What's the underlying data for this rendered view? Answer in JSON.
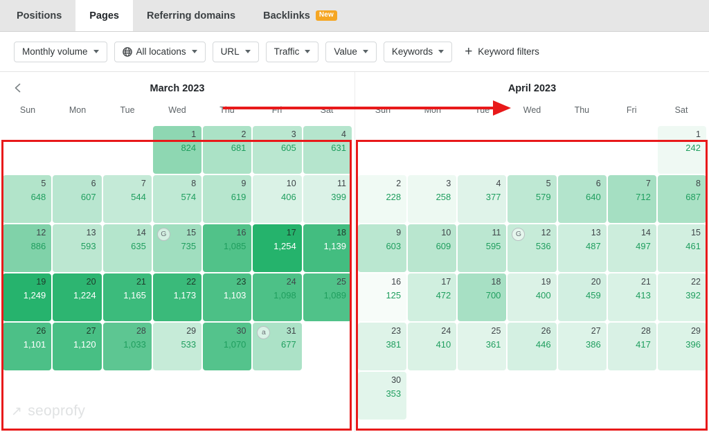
{
  "tabs": [
    {
      "label": "Positions",
      "active": false,
      "badge": null
    },
    {
      "label": "Pages",
      "active": true,
      "badge": null
    },
    {
      "label": "Referring domains",
      "active": false,
      "badge": null
    },
    {
      "label": "Backlinks",
      "active": false,
      "badge": "New"
    }
  ],
  "filters": {
    "buttons": [
      {
        "label": "Monthly volume",
        "icon": null,
        "caret": true
      },
      {
        "label": "All locations",
        "icon": "globe-icon",
        "caret": true
      },
      {
        "label": "URL",
        "icon": null,
        "caret": true
      },
      {
        "label": "Traffic",
        "icon": null,
        "caret": true
      },
      {
        "label": "Value",
        "icon": null,
        "caret": true
      },
      {
        "label": "Keywords",
        "icon": null,
        "caret": true
      }
    ],
    "keyword_filters_label": "Keyword filters",
    "plus_glyph": "+"
  },
  "weekdays": [
    "Sun",
    "Mon",
    "Tue",
    "Wed",
    "Thu",
    "Fri",
    "Sat"
  ],
  "colors": {
    "accent_green": "#1f9e5e",
    "scale_max": "#2eb972",
    "annotation_red": "#e8191a",
    "new_badge": "#f5a623"
  },
  "calendars": [
    {
      "title": "March 2023",
      "has_prev_nav": true,
      "lead_blanks": 3,
      "days": [
        {
          "day": 1,
          "value": "824",
          "n": 824
        },
        {
          "day": 2,
          "value": "681",
          "n": 681
        },
        {
          "day": 3,
          "value": "605",
          "n": 605
        },
        {
          "day": 4,
          "value": "631",
          "n": 631
        },
        {
          "day": 5,
          "value": "648",
          "n": 648
        },
        {
          "day": 6,
          "value": "607",
          "n": 607
        },
        {
          "day": 7,
          "value": "544",
          "n": 544
        },
        {
          "day": 8,
          "value": "574",
          "n": 574
        },
        {
          "day": 9,
          "value": "619",
          "n": 619
        },
        {
          "day": 10,
          "value": "406",
          "n": 406
        },
        {
          "day": 11,
          "value": "399",
          "n": 399
        },
        {
          "day": 12,
          "value": "886",
          "n": 886
        },
        {
          "day": 13,
          "value": "593",
          "n": 593
        },
        {
          "day": 14,
          "value": "635",
          "n": 635
        },
        {
          "day": 15,
          "value": "735",
          "n": 735,
          "badge": "G"
        },
        {
          "day": 16,
          "value": "1,085",
          "n": 1085
        },
        {
          "day": 17,
          "value": "1,254",
          "n": 1254
        },
        {
          "day": 18,
          "value": "1,139",
          "n": 1139
        },
        {
          "day": 19,
          "value": "1,249",
          "n": 1249
        },
        {
          "day": 20,
          "value": "1,224",
          "n": 1224
        },
        {
          "day": 21,
          "value": "1,165",
          "n": 1165
        },
        {
          "day": 22,
          "value": "1,173",
          "n": 1173
        },
        {
          "day": 23,
          "value": "1,103",
          "n": 1103
        },
        {
          "day": 24,
          "value": "1,098",
          "n": 1098
        },
        {
          "day": 25,
          "value": "1,089",
          "n": 1089
        },
        {
          "day": 26,
          "value": "1,101",
          "n": 1101
        },
        {
          "day": 27,
          "value": "1,120",
          "n": 1120
        },
        {
          "day": 28,
          "value": "1,033",
          "n": 1033
        },
        {
          "day": 29,
          "value": "533",
          "n": 533
        },
        {
          "day": 30,
          "value": "1,070",
          "n": 1070
        },
        {
          "day": 31,
          "value": "677",
          "n": 677,
          "badge": "a"
        }
      ]
    },
    {
      "title": "April 2023",
      "has_prev_nav": false,
      "lead_blanks": 6,
      "days": [
        {
          "day": 1,
          "value": "242",
          "n": 242
        },
        {
          "day": 2,
          "value": "228",
          "n": 228
        },
        {
          "day": 3,
          "value": "258",
          "n": 258
        },
        {
          "day": 4,
          "value": "377",
          "n": 377
        },
        {
          "day": 5,
          "value": "579",
          "n": 579
        },
        {
          "day": 6,
          "value": "640",
          "n": 640
        },
        {
          "day": 7,
          "value": "712",
          "n": 712
        },
        {
          "day": 8,
          "value": "687",
          "n": 687
        },
        {
          "day": 9,
          "value": "603",
          "n": 603
        },
        {
          "day": 10,
          "value": "609",
          "n": 609
        },
        {
          "day": 11,
          "value": "595",
          "n": 595
        },
        {
          "day": 12,
          "value": "536",
          "n": 536,
          "badge": "G"
        },
        {
          "day": 13,
          "value": "487",
          "n": 487
        },
        {
          "day": 14,
          "value": "497",
          "n": 497
        },
        {
          "day": 15,
          "value": "461",
          "n": 461
        },
        {
          "day": 16,
          "value": "125",
          "n": 125
        },
        {
          "day": 17,
          "value": "472",
          "n": 472
        },
        {
          "day": 18,
          "value": "700",
          "n": 700
        },
        {
          "day": 19,
          "value": "400",
          "n": 400
        },
        {
          "day": 20,
          "value": "459",
          "n": 459
        },
        {
          "day": 21,
          "value": "413",
          "n": 413
        },
        {
          "day": 22,
          "value": "392",
          "n": 392
        },
        {
          "day": 23,
          "value": "381",
          "n": 381
        },
        {
          "day": 24,
          "value": "410",
          "n": 410
        },
        {
          "day": 25,
          "value": "361",
          "n": 361
        },
        {
          "day": 26,
          "value": "446",
          "n": 446
        },
        {
          "day": 27,
          "value": "386",
          "n": 386
        },
        {
          "day": 28,
          "value": "417",
          "n": 417
        },
        {
          "day": 29,
          "value": "396",
          "n": 396
        },
        {
          "day": 30,
          "value": "353",
          "n": 353
        }
      ]
    }
  ],
  "annotations": {
    "arrow_from_label": "March 2023",
    "arrow_to_label": "April 2023",
    "boxes": [
      "march-calendar",
      "april-calendar"
    ]
  },
  "watermark": {
    "text": "seoprofy",
    "glyph": "↗"
  }
}
